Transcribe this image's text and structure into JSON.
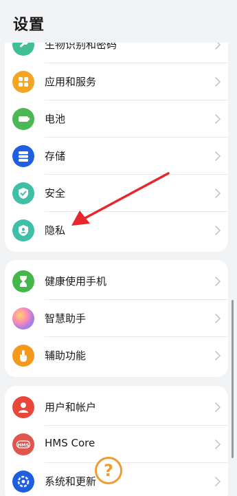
{
  "header": {
    "title": "设置"
  },
  "groups": [
    {
      "items": [
        {
          "label": "生物识别和密码",
          "icon": "fingerprint-icon",
          "color": "#3fbf94"
        },
        {
          "label": "应用和服务",
          "icon": "apps-icon",
          "color": "#f5a524"
        },
        {
          "label": "电池",
          "icon": "battery-icon",
          "color": "#4cb854"
        },
        {
          "label": "存储",
          "icon": "storage-icon",
          "color": "#1f5fe0"
        },
        {
          "label": "安全",
          "icon": "shield-check-icon",
          "color": "#3fbfa6"
        },
        {
          "label": "隐私",
          "icon": "privacy-icon",
          "color": "#3fbfa6"
        }
      ]
    },
    {
      "items": [
        {
          "label": "健康使用手机",
          "icon": "hourglass-icon",
          "color": "#45b64a"
        },
        {
          "label": "智慧助手",
          "icon": "assistant-icon",
          "color": "#b07ae8"
        },
        {
          "label": "辅助功能",
          "icon": "accessibility-icon",
          "color": "#f39a1e"
        }
      ]
    },
    {
      "items": [
        {
          "label": "用户和帐户",
          "icon": "user-icon",
          "color": "#e8473a"
        },
        {
          "label": "HMS Core",
          "icon": "hms-icon",
          "color": "#e0554c"
        },
        {
          "label": "系统和更新",
          "icon": "system-update-icon",
          "color": "#1e5fe0"
        }
      ]
    }
  ],
  "annotation": {
    "color": "#e8262c"
  },
  "help_badge": {
    "text": "?",
    "color": "#f39a2e"
  }
}
